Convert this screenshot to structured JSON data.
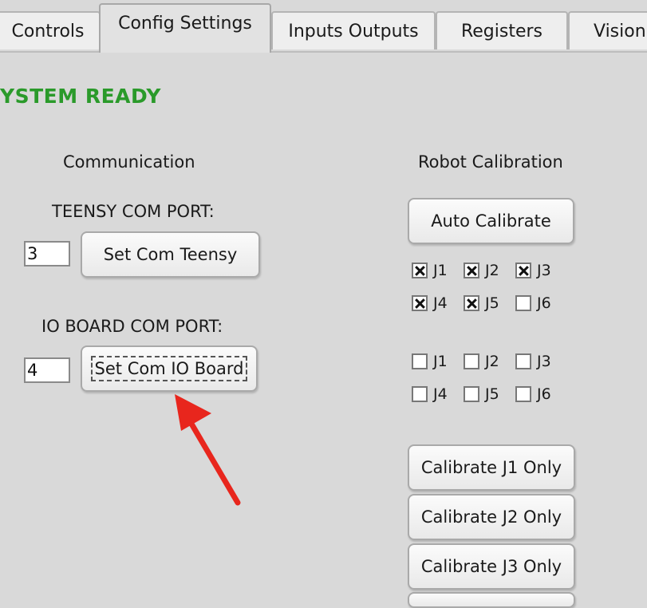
{
  "tabs": [
    {
      "label": "Controls",
      "active": false
    },
    {
      "label": "Config Settings",
      "active": true
    },
    {
      "label": "Inputs Outputs",
      "active": false
    },
    {
      "label": "Registers",
      "active": false
    },
    {
      "label": "Vision",
      "active": false
    }
  ],
  "status": "YSTEM READY",
  "colors": {
    "status": "#2a9a2a",
    "arrow": "#e8261d"
  },
  "communication": {
    "title": "Communication",
    "teensy": {
      "label": "TEENSY COM PORT:",
      "value": "3",
      "button": "Set Com Teensy"
    },
    "io_board": {
      "label": "IO BOARD COM PORT:",
      "value": "4",
      "button": "Set Com IO Board"
    }
  },
  "calibration": {
    "title": "Robot Calibration",
    "auto_button": "Auto Calibrate",
    "set1": [
      {
        "label": "J1",
        "checked": true
      },
      {
        "label": "J2",
        "checked": true
      },
      {
        "label": "J3",
        "checked": true
      },
      {
        "label": "J4",
        "checked": true
      },
      {
        "label": "J5",
        "checked": true
      },
      {
        "label": "J6",
        "checked": false
      }
    ],
    "set2": [
      {
        "label": "J1",
        "checked": false
      },
      {
        "label": "J2",
        "checked": false
      },
      {
        "label": "J3",
        "checked": false
      },
      {
        "label": "J4",
        "checked": false
      },
      {
        "label": "J5",
        "checked": false
      },
      {
        "label": "J6",
        "checked": false
      }
    ],
    "buttons": [
      "Calibrate J1 Only",
      "Calibrate J2 Only",
      "Calibrate J3 Only"
    ]
  },
  "annotation": {
    "icon": "red-arrow-icon"
  }
}
